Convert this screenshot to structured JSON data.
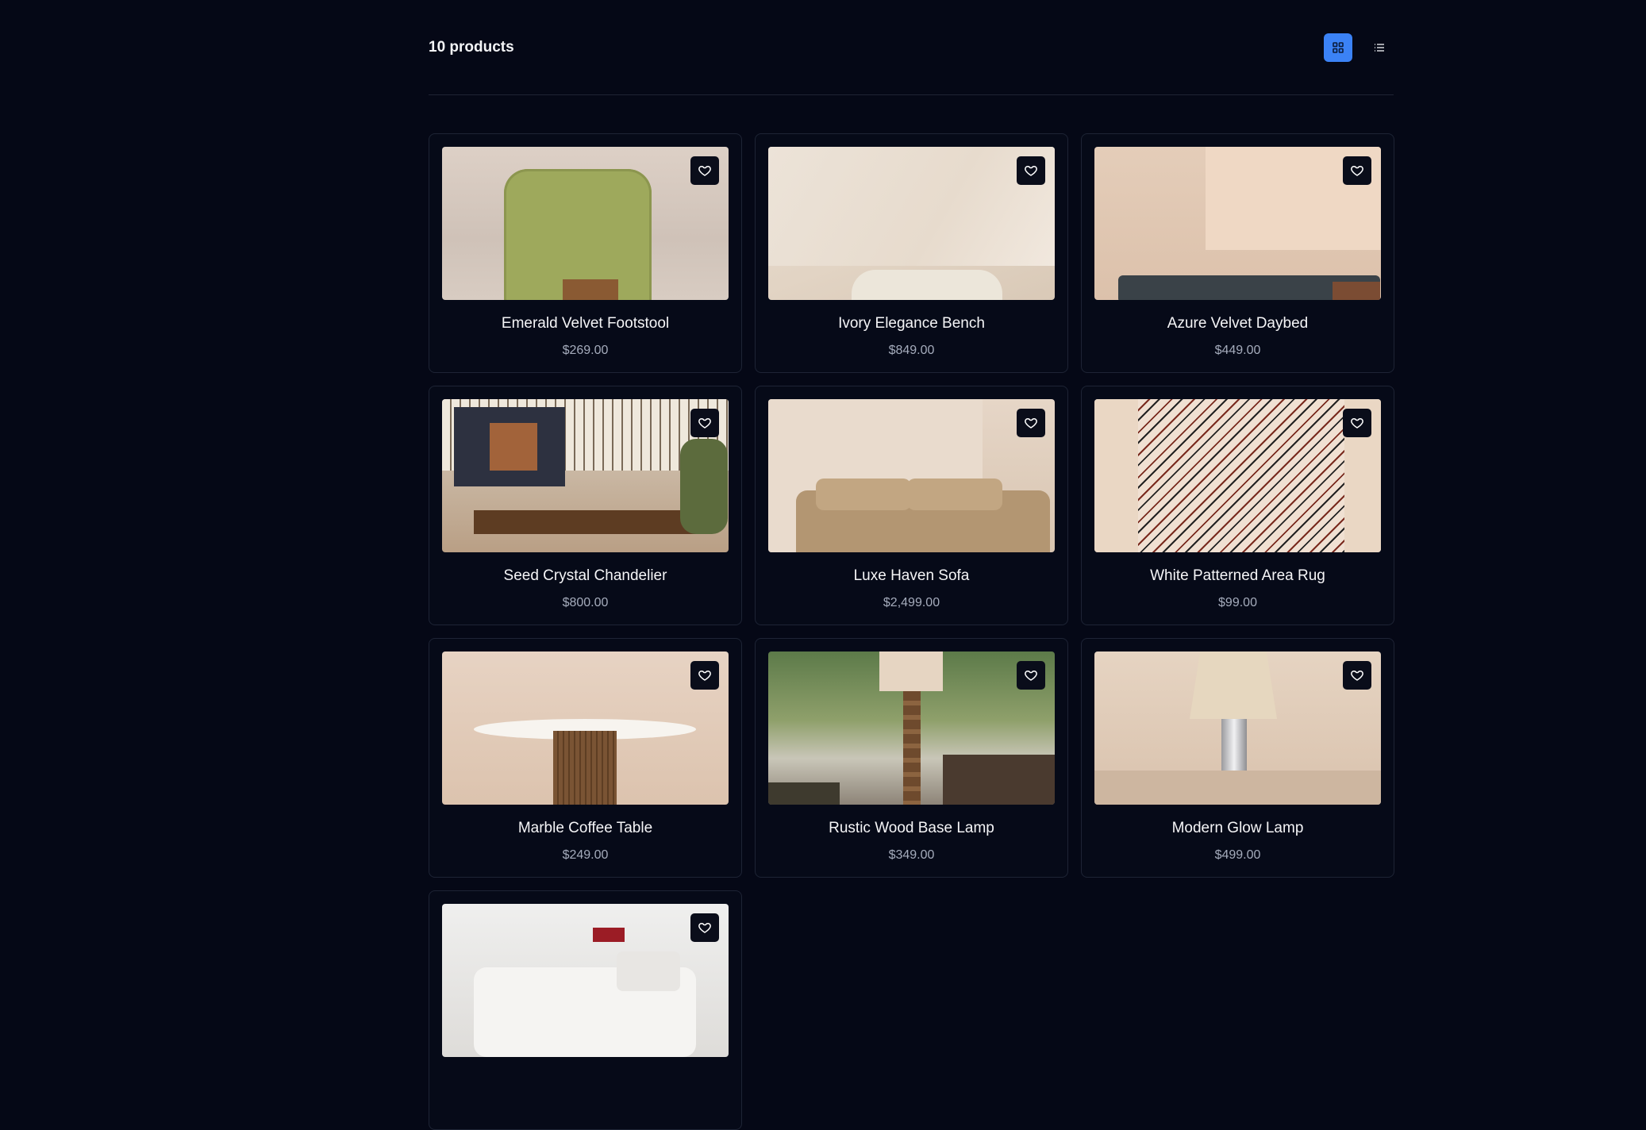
{
  "toolbar": {
    "count_label": "10 products",
    "grid_view_icon": "grid-icon",
    "list_view_icon": "list-icon",
    "accent_color": "#3b82f6"
  },
  "products": [
    {
      "name": "Emerald Velvet Footstool",
      "price": "$269.00"
    },
    {
      "name": "Ivory Elegance Bench",
      "price": "$849.00"
    },
    {
      "name": "Azure Velvet Daybed",
      "price": "$449.00"
    },
    {
      "name": "Seed Crystal Chandelier",
      "price": "$800.00"
    },
    {
      "name": "Luxe Haven Sofa",
      "price": "$2,499.00"
    },
    {
      "name": "White Patterned Area Rug",
      "price": "$99.00"
    },
    {
      "name": "Marble Coffee Table",
      "price": "$249.00"
    },
    {
      "name": "Rustic Wood Base Lamp",
      "price": "$349.00"
    },
    {
      "name": "Modern Glow Lamp",
      "price": "$499.00"
    },
    {
      "name": "",
      "price": ""
    }
  ],
  "favorite_icon": "heart-icon"
}
